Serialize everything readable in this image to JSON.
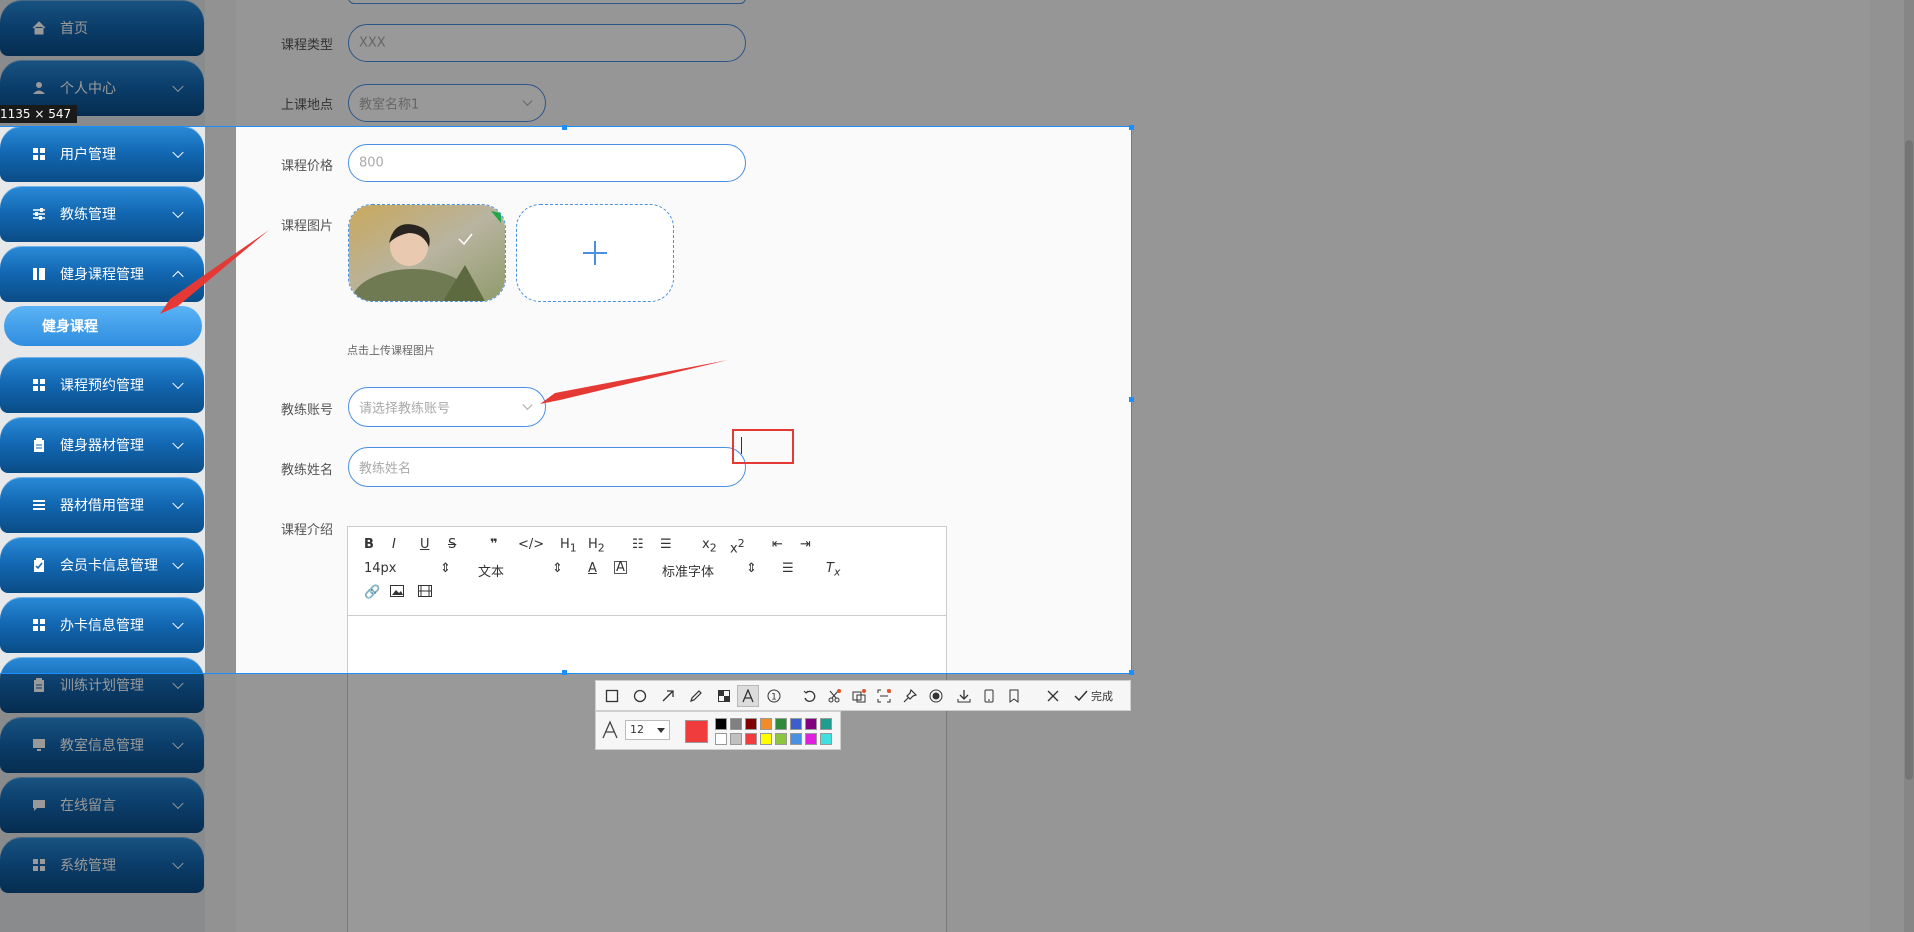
{
  "sidebar": {
    "items": [
      {
        "label": "首页",
        "icon": "home-icon",
        "expandable": false
      },
      {
        "label": "个人中心",
        "icon": "user-icon",
        "expandable": true
      },
      {
        "label": "用户管理",
        "icon": "grid-icon",
        "expandable": true
      },
      {
        "label": "教练管理",
        "icon": "sliders-icon",
        "expandable": true
      },
      {
        "label": "健身课程管理",
        "icon": "book-icon",
        "expandable": true,
        "expanded": true
      },
      {
        "label": "课程预约管理",
        "icon": "grid-icon",
        "expandable": true
      },
      {
        "label": "健身器材管理",
        "icon": "clipboard-icon",
        "expandable": true
      },
      {
        "label": "器材借用管理",
        "icon": "list-icon",
        "expandable": true
      },
      {
        "label": "会员卡信息管理",
        "icon": "clipboard-check-icon",
        "expandable": true
      },
      {
        "label": "办卡信息管理",
        "icon": "grid-icon",
        "expandable": true
      },
      {
        "label": "训练计划管理",
        "icon": "clipboard-icon",
        "expandable": true
      },
      {
        "label": "教室信息管理",
        "icon": "monitor-icon",
        "expandable": true
      },
      {
        "label": "在线留言",
        "icon": "chat-icon",
        "expandable": true
      },
      {
        "label": "系统管理",
        "icon": "grid-icon",
        "expandable": true
      }
    ],
    "sub_item": {
      "label": "健身课程"
    }
  },
  "form": {
    "course_type": {
      "label": "课程类型",
      "value": "XXX"
    },
    "location": {
      "label": "上课地点",
      "value": "教室名称1"
    },
    "price": {
      "label": "课程价格",
      "value": "800"
    },
    "image": {
      "label": "课程图片",
      "hint": "点击上传课程图片"
    },
    "coach_account": {
      "label": "教练账号",
      "placeholder": "请选择教练账号"
    },
    "coach_name": {
      "label": "教练姓名",
      "placeholder": "教练姓名"
    },
    "intro": {
      "label": "课程介绍"
    }
  },
  "editor_toolbar": {
    "font_size": "14px",
    "text_style": "文本",
    "font_family": "标准字体"
  },
  "screenshot_tool": {
    "size_readout": "1135 × 547",
    "done_label": "完成",
    "font_size_value": "12",
    "current_color": "#f03c3c",
    "palette_top": [
      "#000000",
      "#808080",
      "#800000",
      "#f28c28",
      "#2e8b3a",
      "#3a5fcd",
      "#800080",
      "#1e9e8e"
    ],
    "palette_bottom": [
      "#ffffff",
      "#c0c0c0",
      "#f03c3c",
      "#ffff00",
      "#8cc63f",
      "#4a90e2",
      "#e020e0",
      "#40e0e0"
    ]
  },
  "colors": {
    "accent": "#4a90e2",
    "nav": "#1266b0",
    "arrow": "#e53935"
  }
}
